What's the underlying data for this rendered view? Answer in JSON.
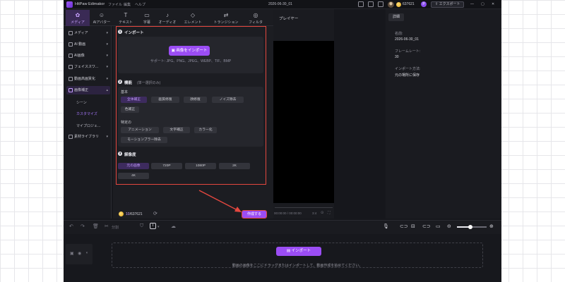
{
  "app": {
    "name": "HitPaw Edimakor",
    "menu": [
      "ファイル",
      "編集",
      "ヘルプ"
    ],
    "project_title": "2026-06-30_01",
    "credits": "637621",
    "pro_badge": "P",
    "export_label": "エクスポート"
  },
  "toolbar": {
    "items": [
      {
        "label": "メディア",
        "icon": "media-icon",
        "glyph": "✿"
      },
      {
        "label": "AIアバター",
        "icon": "ai-avatar-icon",
        "glyph": "☺"
      },
      {
        "label": "テキスト",
        "icon": "text-icon",
        "glyph": "T"
      },
      {
        "label": "字幕",
        "icon": "subtitle-icon",
        "glyph": "▭"
      },
      {
        "label": "オーディオ",
        "icon": "audio-icon",
        "glyph": "♪"
      },
      {
        "label": "エレメント",
        "icon": "element-icon",
        "glyph": "◇"
      },
      {
        "label": "トランジション",
        "icon": "transition-icon",
        "glyph": "⇄"
      },
      {
        "label": "フィルタ",
        "icon": "filter-icon",
        "glyph": "◎"
      }
    ]
  },
  "sidebar": {
    "items": [
      {
        "label": "メディア"
      },
      {
        "label": "AI 動画"
      },
      {
        "label": "AI画像"
      },
      {
        "label": "フェイススワ..."
      },
      {
        "label": "動画高画質化"
      },
      {
        "label": "画像補正"
      }
    ],
    "sub_items": [
      "シーン",
      "カスタマイズ",
      "マイプロジェ..."
    ],
    "library": "素材ライブラリ"
  },
  "panel": {
    "import": {
      "num": "1",
      "title": "インポート",
      "button": "画像をインポート",
      "support": "サポート: JPG、PNG、JPEG、WEBP、TIF、BMP"
    },
    "function": {
      "num": "2",
      "title": "機能",
      "hint": "(単一選択のみ)",
      "basic_label": "基本",
      "basic": [
        "全体補正",
        "画質修復",
        "顔修復",
        "ノイズ除去",
        "色補正"
      ],
      "special_label": "特定の",
      "special": [
        "アニメーション",
        "文字補正",
        "カラー化",
        "モーションブラー除去"
      ]
    },
    "resolution": {
      "num": "3",
      "title": "解像度",
      "options": [
        "元の画像",
        "720P",
        "1080P",
        "2K",
        "4K"
      ]
    },
    "credits": {
      "used": "10",
      "total": "/637621"
    },
    "create_label": "作成する"
  },
  "player": {
    "title": "プレイヤー",
    "time": "00:00:00 / 00:00:00",
    "ratio": "3:4"
  },
  "details": {
    "tab": "詳細",
    "name_label": "名前:",
    "name_value": "2026-06-30_01",
    "fps_label": "フレームレート:",
    "fps_value": "30",
    "import_label": "インポート方法:",
    "import_value": "元の場所に保存"
  },
  "timeline": {
    "split_label": "分割",
    "import_label": "インポート",
    "drop_hint": "動画の画像をここにドラッグまたはインポートして、動画作成を始めてください。",
    "zoom_level": 0.45
  },
  "colors": {
    "accent": "#9b4df4",
    "highlight": "#e4473f",
    "background": "#16171c"
  }
}
